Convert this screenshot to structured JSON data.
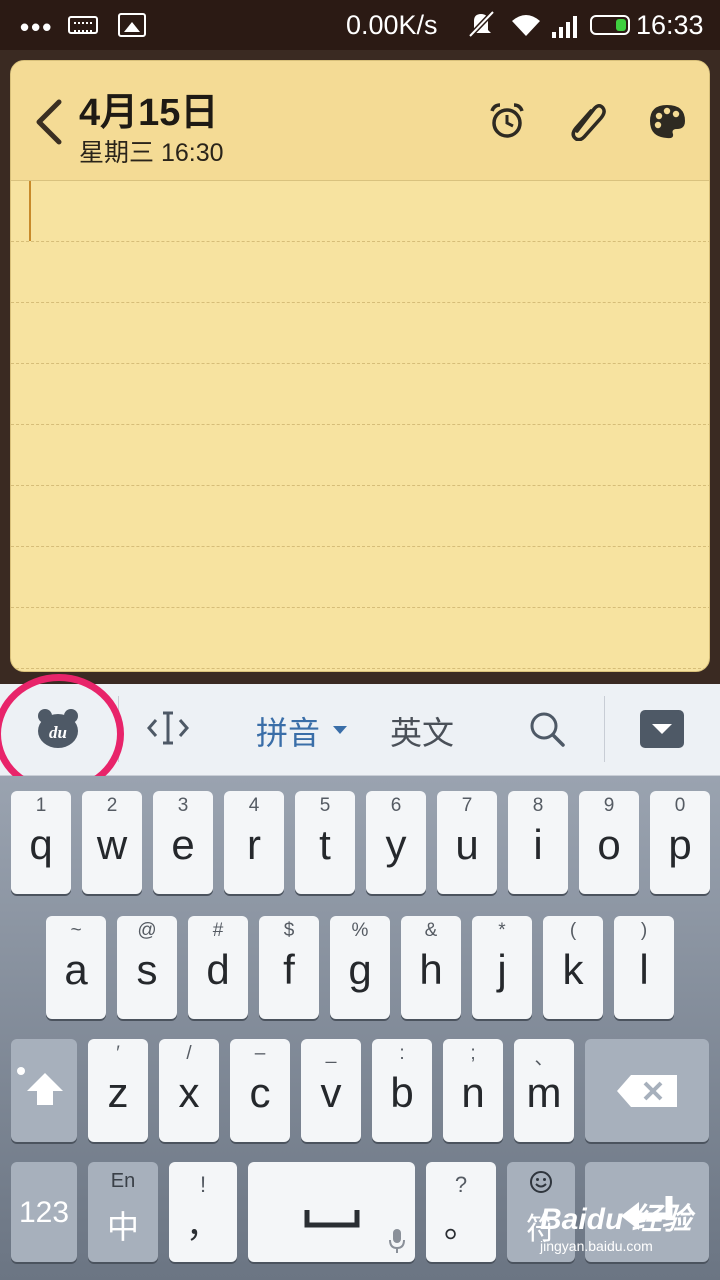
{
  "status_bar": {
    "left_icons": [
      "more-dots-icon",
      "keyboard-icon",
      "image-icon"
    ],
    "dots": "•••",
    "net_speed": "0.00K/s",
    "right_icons": [
      "mute-icon",
      "wifi-icon",
      "signal-icon",
      "battery-icon"
    ],
    "time": "16:33"
  },
  "note": {
    "date": "4月15日",
    "subtitle": "星期三 16:30",
    "header_icons": [
      "back-icon",
      "alarm-icon",
      "attachment-icon",
      "palette-icon"
    ],
    "paper_color": "#f7e3a0"
  },
  "ime_toolbar": {
    "logo": "du",
    "mode_pinyin": "拼音",
    "mode_english": "英文",
    "icons": [
      "du-logo-icon",
      "cursor-move-icon",
      "search-icon",
      "collapse-keyboard-icon"
    ],
    "highlight_color": "#e8246a"
  },
  "keyboard": {
    "row1": [
      {
        "sub": "1",
        "key": "q"
      },
      {
        "sub": "2",
        "key": "w"
      },
      {
        "sub": "3",
        "key": "e"
      },
      {
        "sub": "4",
        "key": "r"
      },
      {
        "sub": "5",
        "key": "t"
      },
      {
        "sub": "6",
        "key": "y"
      },
      {
        "sub": "7",
        "key": "u"
      },
      {
        "sub": "8",
        "key": "i"
      },
      {
        "sub": "9",
        "key": "o"
      },
      {
        "sub": "0",
        "key": "p"
      }
    ],
    "row2": [
      {
        "sub": "~",
        "key": "a"
      },
      {
        "sub": "@",
        "key": "s"
      },
      {
        "sub": "#",
        "key": "d"
      },
      {
        "sub": "$",
        "key": "f"
      },
      {
        "sub": "%",
        "key": "g"
      },
      {
        "sub": "&",
        "key": "h"
      },
      {
        "sub": "*",
        "key": "j"
      },
      {
        "sub": "(",
        "key": "k"
      },
      {
        "sub": ")",
        "key": "l"
      }
    ],
    "row3": [
      {
        "sub": "′",
        "key": "z"
      },
      {
        "sub": "/",
        "key": "x"
      },
      {
        "sub": "–",
        "key": "c"
      },
      {
        "sub": "_",
        "key": "v"
      },
      {
        "sub": ":",
        "key": "b"
      },
      {
        "sub": ";",
        "key": "n"
      },
      {
        "sub": "、",
        "key": "m"
      }
    ],
    "num_key": "123",
    "lang_top": "En",
    "lang_bottom": "中",
    "comma_top": "!",
    "comma": "，",
    "period_top": "?",
    "period": "。",
    "symbol_key": "符",
    "icons": [
      "shift-icon",
      "backspace-icon",
      "space-icon",
      "mic-icon",
      "emoji-icon",
      "enter-icon"
    ]
  },
  "watermark": {
    "brand": "Baidu 经验",
    "url": "jingyan.baidu.com"
  }
}
